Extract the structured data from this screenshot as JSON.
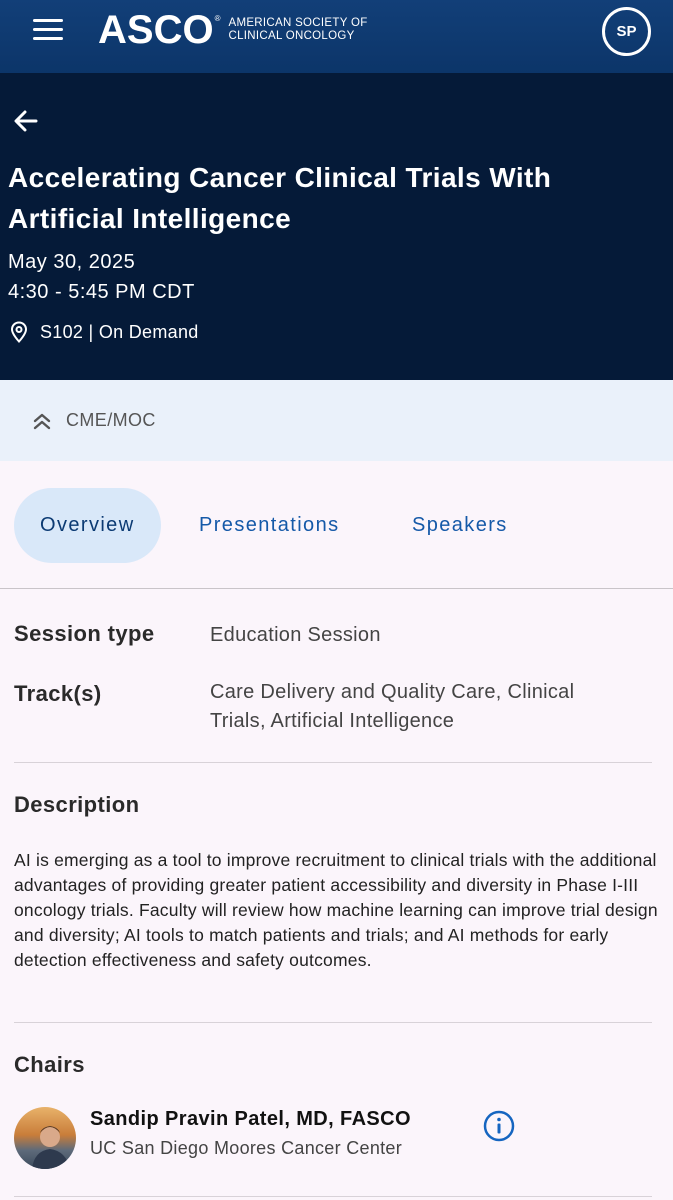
{
  "header": {
    "logo_mark": "ASCO",
    "logo_reg": "®",
    "logo_line1": "AMERICAN SOCIETY OF",
    "logo_line2": "CLINICAL ONCOLOGY",
    "avatar_initials": "SP",
    "menu_icon": "hamburger-menu-icon",
    "brand_color": "#123f78"
  },
  "hero": {
    "back_icon": "arrow-left-icon",
    "title": "Accelerating Cancer Clinical Trials With Artificial Intelligence",
    "date": "May 30, 2025",
    "time": "4:30 - 5:45 PM CDT",
    "location_icon": "map-pin-icon",
    "location": "S102 | On Demand",
    "background": "#051a38"
  },
  "cme": {
    "icon": "double-chevron-up-icon",
    "label": "CME/MOC"
  },
  "tabs": [
    {
      "label": "Overview",
      "active": true
    },
    {
      "label": "Presentations",
      "active": false
    },
    {
      "label": "Speakers",
      "active": false
    }
  ],
  "details": {
    "session_type_label": "Session type",
    "session_type_value": "Education Session",
    "tracks_label": "Track(s)",
    "tracks_value_line1": "Care Delivery and Quality Care, Clinical",
    "tracks_value_line2": "Trials, Artificial Intelligence"
  },
  "description": {
    "heading": "Description",
    "text": "AI is emerging as a tool to improve recruitment to clinical trials with the additional advantages of providing greater patient accessibility and diversity in Phase I-III oncology trials. Faculty will review how machine learning can improve trial design and diversity; AI tools to match patients and trials; and AI methods for early detection effectiveness and safety outcomes."
  },
  "chairs": {
    "heading": "Chairs",
    "items": [
      {
        "name": "Sandip Pravin Patel, MD, FASCO",
        "org": "UC San Diego Moores Cancer Center",
        "info_icon": "info-circle-icon"
      }
    ]
  }
}
